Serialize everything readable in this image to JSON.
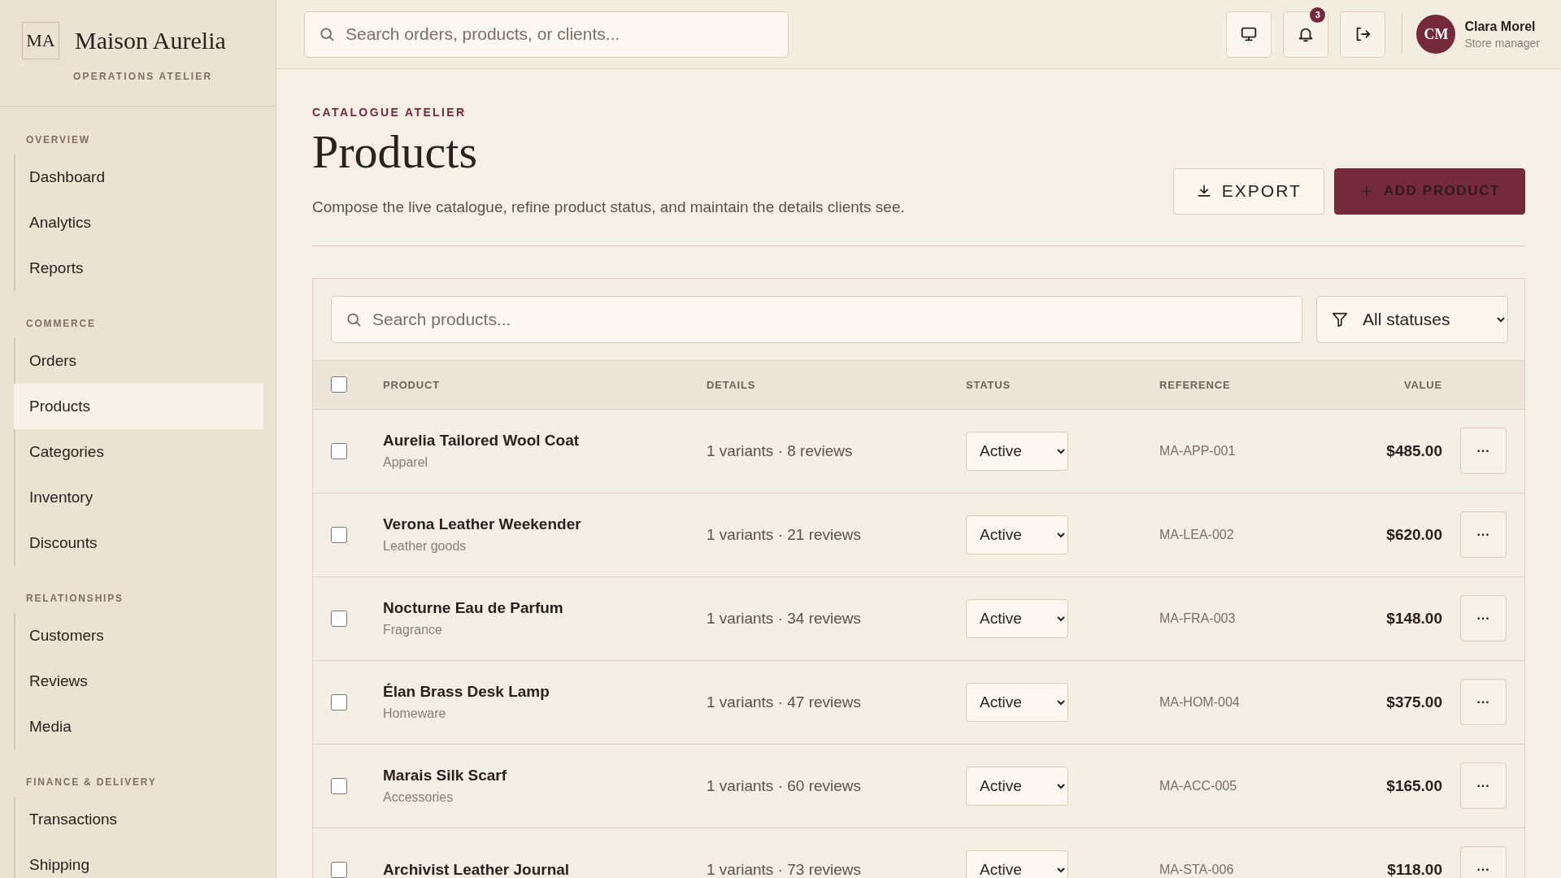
{
  "brand": {
    "monogram": "MA",
    "name": "Maison Aurelia",
    "tagline": "OPERATIONS ATELIER"
  },
  "sidebar": {
    "sections": [
      {
        "label": "OVERVIEW",
        "items": [
          {
            "label": "Dashboard",
            "selected": false
          },
          {
            "label": "Analytics",
            "selected": false
          },
          {
            "label": "Reports",
            "selected": false
          }
        ]
      },
      {
        "label": "COMMERCE",
        "items": [
          {
            "label": "Orders",
            "selected": false
          },
          {
            "label": "Products",
            "selected": true
          },
          {
            "label": "Categories",
            "selected": false
          },
          {
            "label": "Inventory",
            "selected": false
          },
          {
            "label": "Discounts",
            "selected": false
          }
        ]
      },
      {
        "label": "RELATIONSHIPS",
        "items": [
          {
            "label": "Customers",
            "selected": false
          },
          {
            "label": "Reviews",
            "selected": false
          },
          {
            "label": "Media",
            "selected": false
          }
        ]
      },
      {
        "label": "FINANCE & DELIVERY",
        "items": [
          {
            "label": "Transactions",
            "selected": false
          },
          {
            "label": "Shipping",
            "selected": false
          }
        ]
      }
    ]
  },
  "header": {
    "search": {
      "placeholder": "Search orders, products, or clients..."
    },
    "notifications": "3",
    "user": {
      "initials": "CM",
      "name": "Clara Morel",
      "role": "Store manager"
    }
  },
  "page": {
    "eyebrow": "CATALOGUE ATELIER",
    "title": "Products",
    "description": "Compose the live catalogue, refine product status, and maintain the details clients see.",
    "buttons": [
      {
        "kind": "secondary",
        "label": "EXPORT"
      },
      {
        "kind": "primary",
        "label": "ADD PRODUCT"
      }
    ]
  },
  "table": {
    "search": {
      "placeholder": "Search products..."
    },
    "filter": "All statuses",
    "select_all": {
      "checked": false
    },
    "columns": [
      "PRODUCT",
      "DETAILS",
      "STATUS",
      "REFERENCE",
      "VALUE"
    ],
    "rows": [
      {
        "checked": false,
        "name": "Aurelia Tailored Wool Coat",
        "category": "Apparel",
        "details": "1 variants · 8 reviews",
        "status": "Active",
        "reference": "MA-APP-001",
        "value": "$485.00",
        "menu": "···"
      },
      {
        "checked": false,
        "name": "Verona Leather Weekender",
        "category": "Leather goods",
        "details": "1 variants · 21 reviews",
        "status": "Active",
        "reference": "MA-LEA-002",
        "value": "$620.00",
        "menu": "···"
      },
      {
        "checked": false,
        "name": "Nocturne Eau de Parfum",
        "category": "Fragrance",
        "details": "1 variants · 34 reviews",
        "status": "Active",
        "reference": "MA-FRA-003",
        "value": "$148.00",
        "menu": "···"
      },
      {
        "checked": false,
        "name": "Élan Brass Desk Lamp",
        "category": "Homeware",
        "details": "1 variants · 47 reviews",
        "status": "Active",
        "reference": "MA-HOM-004",
        "value": "$375.00",
        "menu": "···"
      },
      {
        "checked": false,
        "name": "Marais Silk Scarf",
        "category": "Accessories",
        "details": "1 variants · 60 reviews",
        "status": "Active",
        "reference": "MA-ACC-005",
        "value": "$165.00",
        "menu": "···"
      },
      {
        "checked": false,
        "name": "Archivist Leather Journal",
        "details": "1 variants · 73 reviews",
        "status": "Active",
        "reference": "MA-STA-006",
        "value": "$118.00",
        "menu": "···"
      }
    ]
  }
}
